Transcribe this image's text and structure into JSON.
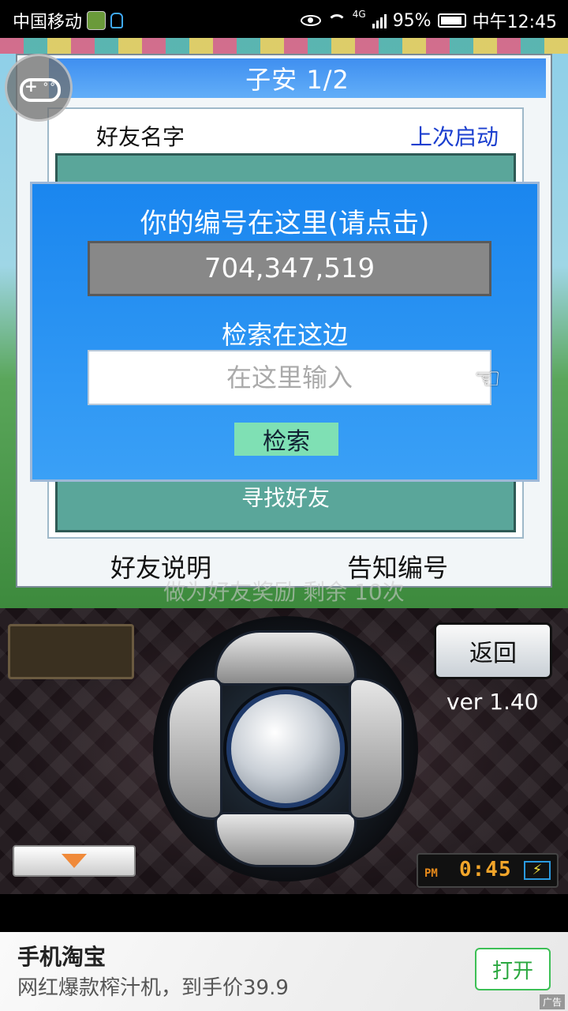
{
  "status_bar": {
    "carrier": "中国移动",
    "network": "4G",
    "battery": "95%",
    "time": "中午12:45"
  },
  "dialog": {
    "title": "子安 1/2",
    "column_name": "好友名字",
    "column_last": "上次启动",
    "find_friend": "寻找好友",
    "footer_left": "好友说明",
    "footer_right": "告知编号",
    "behind_text": "做为好友奖励 剩余 10次"
  },
  "overlay": {
    "title": "你的编号在这里(请点击)",
    "user_number": "704,347,519",
    "search_label": "检索在这边",
    "search_placeholder": "在这里输入",
    "search_button": "检索"
  },
  "controller": {
    "back_button": "返回",
    "version": "ver 1.40",
    "clock_period": "PM",
    "clock_time": "0:45"
  },
  "ad": {
    "title": "手机淘宝",
    "description": "网红爆款榨汁机，到手价39.9",
    "open_button": "打开",
    "badge": "广告"
  }
}
